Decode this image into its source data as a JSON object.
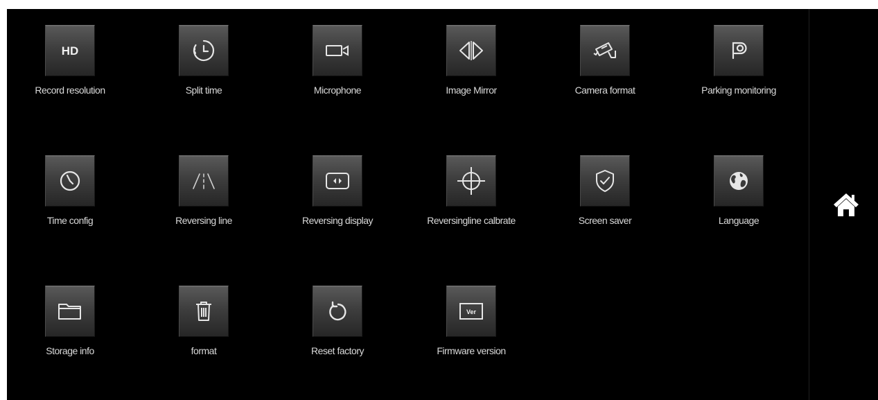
{
  "menu": {
    "items": [
      {
        "id": "record-resolution",
        "label": "Record resolution",
        "icon": "hd-icon",
        "icon_text": "HD"
      },
      {
        "id": "split-time",
        "label": "Split time",
        "icon": "timer-icon"
      },
      {
        "id": "microphone",
        "label": "Microphone",
        "icon": "video-camera-icon"
      },
      {
        "id": "image-mirror",
        "label": "Image Mirror",
        "icon": "mirror-arrows-icon"
      },
      {
        "id": "camera-format",
        "label": "Camera format",
        "icon": "security-camera-icon"
      },
      {
        "id": "parking-monitoring",
        "label": "Parking monitoring",
        "icon": "parking-icon"
      },
      {
        "id": "time-config",
        "label": "Time config",
        "icon": "clock-icon"
      },
      {
        "id": "reversing-line",
        "label": "Reversing line",
        "icon": "road-lines-icon"
      },
      {
        "id": "reversing-display",
        "label": "Reversing display",
        "icon": "display-arrows-icon"
      },
      {
        "id": "reversing-line-calibrate",
        "label": "Reversingline calbrate",
        "icon": "crosshair-icon"
      },
      {
        "id": "screen-saver",
        "label": "Screen saver",
        "icon": "shield-check-icon"
      },
      {
        "id": "language",
        "label": "Language",
        "icon": "globe-icon"
      },
      {
        "id": "storage-info",
        "label": "Storage info",
        "icon": "folder-icon"
      },
      {
        "id": "format",
        "label": "format",
        "icon": "trash-icon"
      },
      {
        "id": "reset-factory",
        "label": "Reset factory",
        "icon": "reset-icon"
      },
      {
        "id": "firmware-version",
        "label": "Firmware version",
        "icon": "version-icon",
        "icon_text": "Ver"
      }
    ]
  },
  "sidebar": {
    "home_icon": "home-icon"
  },
  "colors": {
    "background": "#000000",
    "label_text": "#d9d9d9",
    "icon_stroke": "#e6e6e6"
  }
}
